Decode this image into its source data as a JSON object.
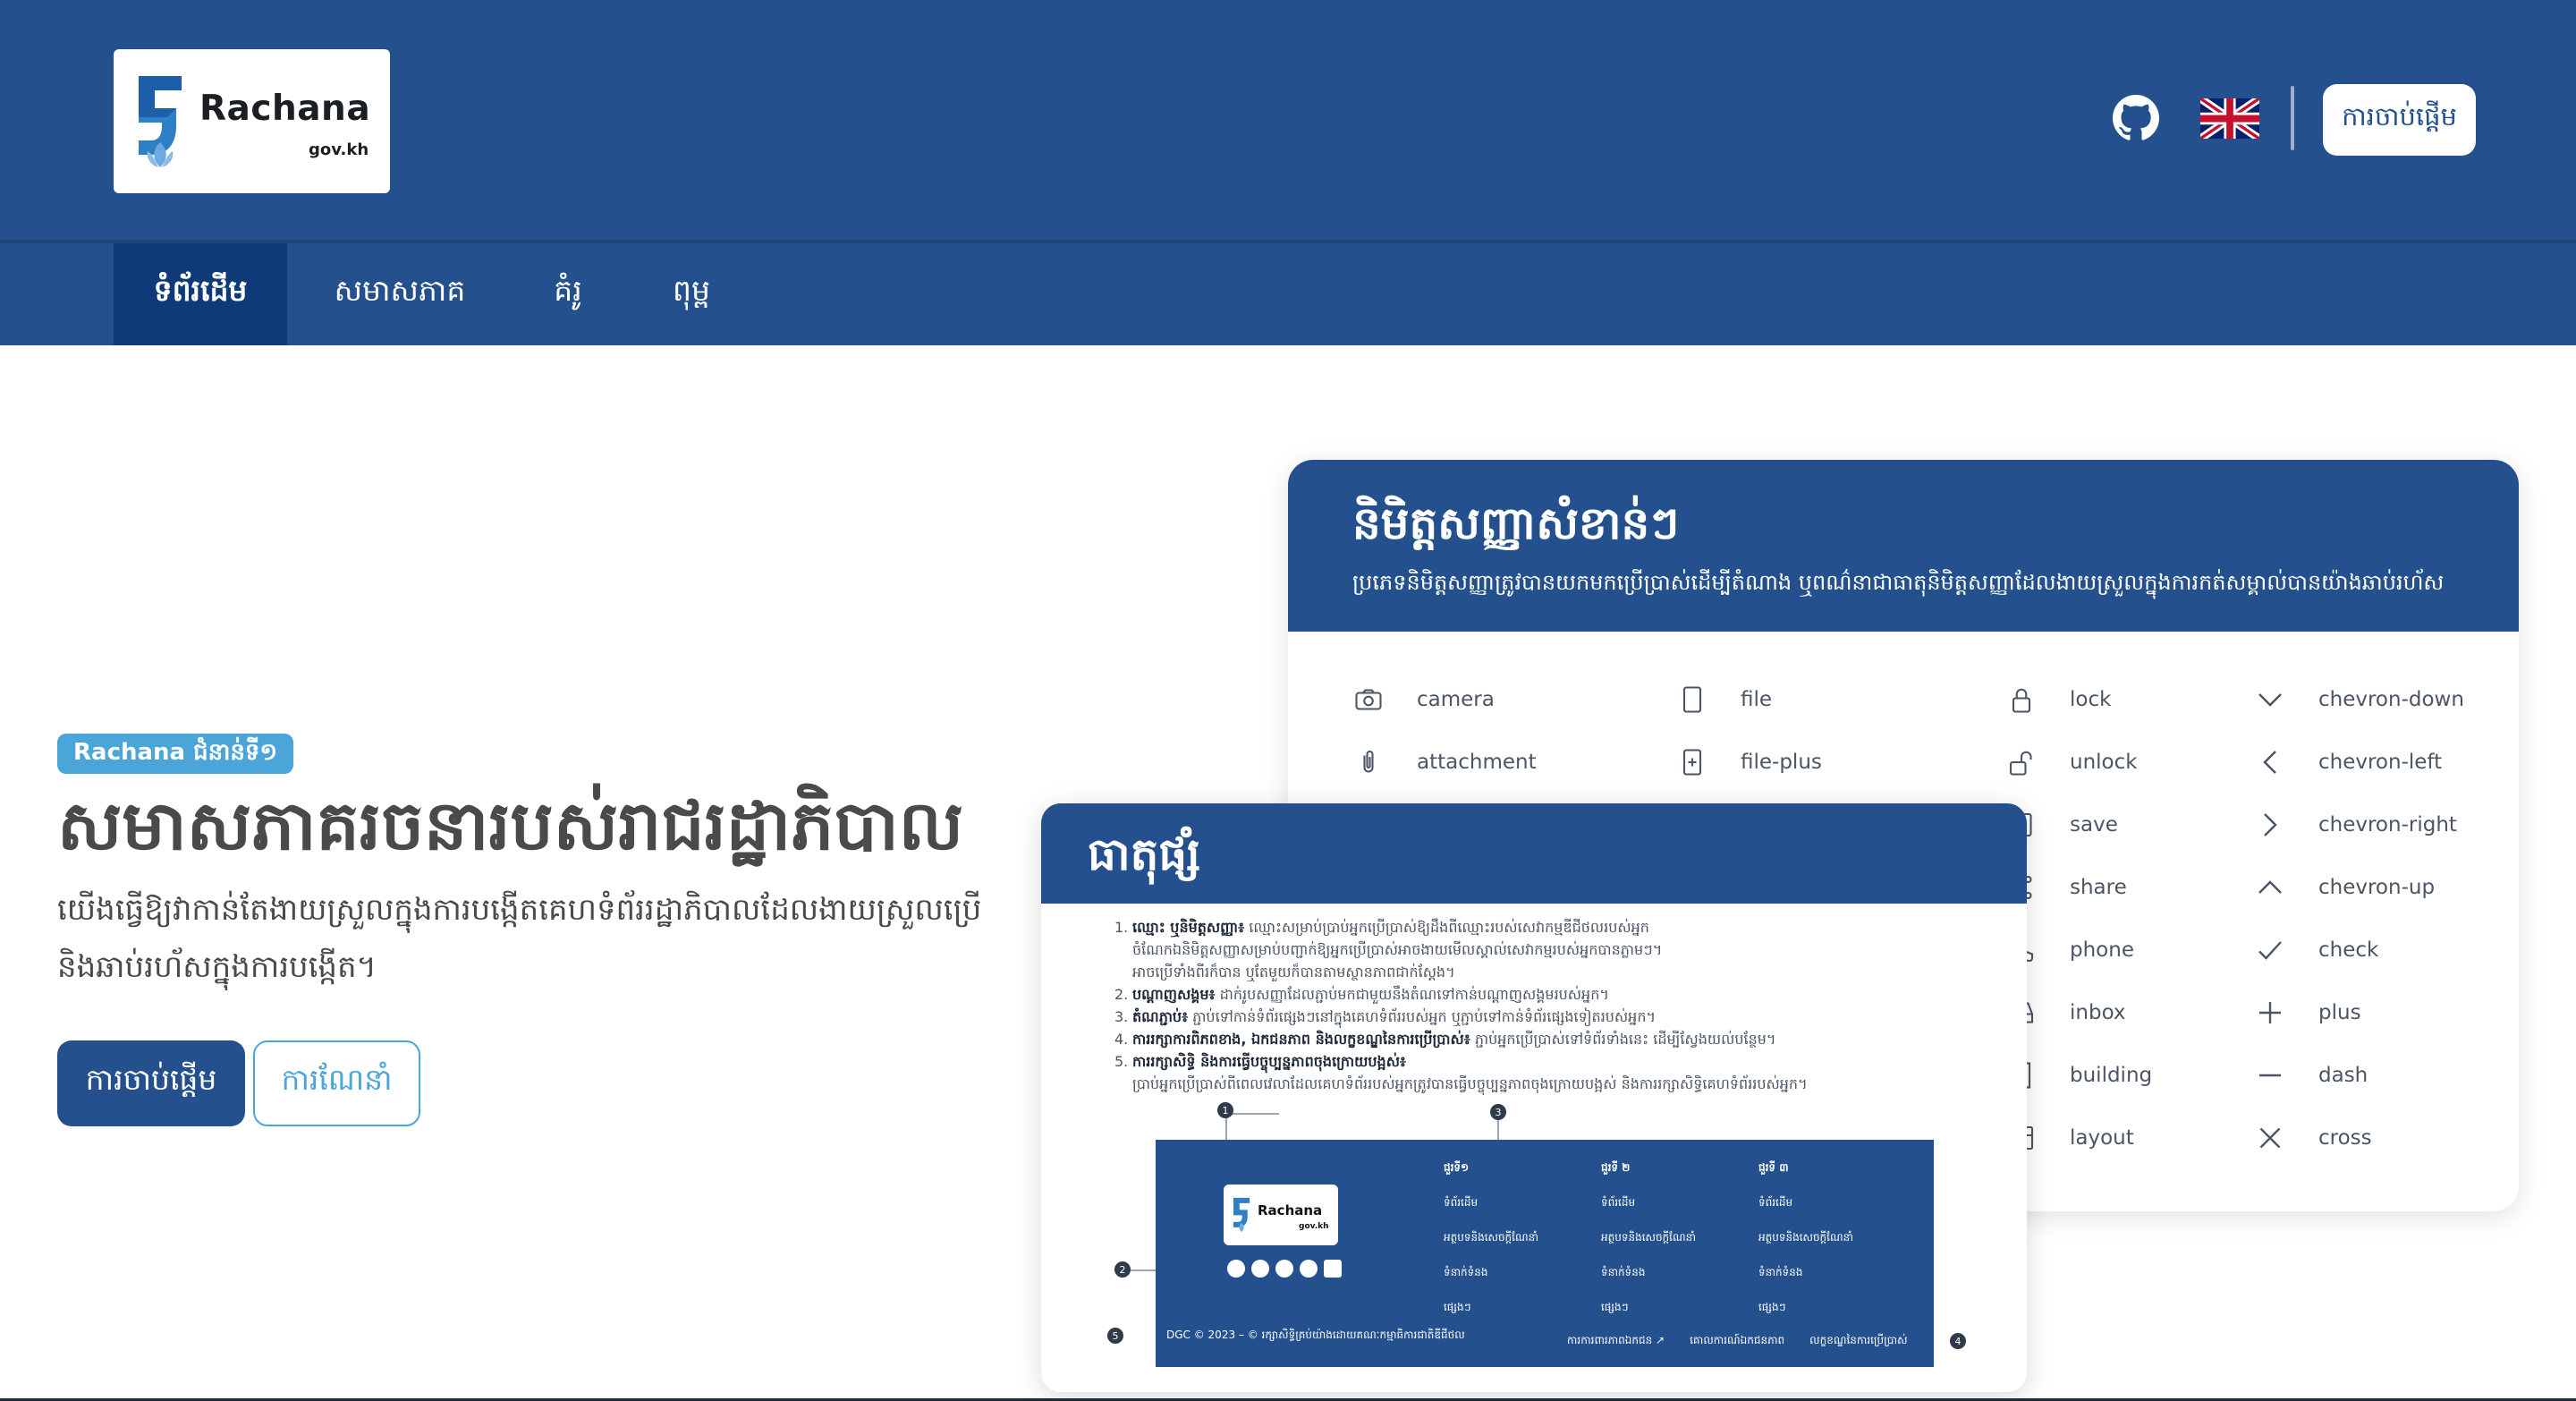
{
  "header": {
    "logo": {
      "wordmark": "Rachana",
      "domain": "gov.kh"
    },
    "icons": {
      "github": "github-icon",
      "language": "uk-flag-icon"
    },
    "start_button": "ការចាប់ផ្តើម"
  },
  "nav": {
    "items": [
      {
        "label": "ទំព័រដើម",
        "active": true
      },
      {
        "label": "សមាសភាគ",
        "active": false
      },
      {
        "label": "គំរូ",
        "active": false
      },
      {
        "label": "ពុម្ព",
        "active": false
      }
    ]
  },
  "hero": {
    "badge": "Rachana ជំនាន់ទី១",
    "title": "សមាសភាគរចនារបស់រាជរដ្ឋាភិបាល",
    "description": "យើងធ្វើឱ្យវាកាន់តែងាយស្រួលក្នុងការបង្កើតគេហទំព័ររដ្ឋាភិបាលដែលងាយស្រួលប្រើ និងឆាប់រហ័សក្នុងការបង្កើត។",
    "primary_button": "ការចាប់ផ្តើម",
    "secondary_button": "ការណែនាំ"
  },
  "icon_card": {
    "title": "និមិត្តសញ្ញាសំខាន់ៗ",
    "subtitle": "ប្រភេទនិមិត្តសញ្ញាត្រូវបានយកមកប្រើប្រាស់ដើម្បីតំណាង ឬពណ៌នាជាធាតុនិមិត្តសញ្ញាដែលងាយស្រួលក្នុងការកត់សម្គាល់បានយ៉ាងឆាប់រហ័ស",
    "icons": [
      "camera",
      "attachment",
      "file",
      "file-plus",
      "lock",
      "unlock",
      "save",
      "share",
      "phone",
      "inbox",
      "building",
      "layout",
      "chevron-down",
      "chevron-left",
      "chevron-right",
      "chevron-up",
      "check",
      "plus",
      "dash",
      "cross"
    ]
  },
  "component_card": {
    "title": "ធាតុផ្សំ",
    "notes": [
      {
        "n": "1.",
        "bold": "ឈ្មោះ ឬនិមិត្តសញ្ញា៖",
        "text": " ឈ្មោះសម្រាប់ប្រាប់អ្នកប្រើប្រាស់ឱ្យដឹងពីឈ្មោះរបស់សេវាកម្មឌីជីថលរបស់អ្នក"
      },
      {
        "n": "",
        "bold": "",
        "text": "ចំណែកឯនិមិត្តសញ្ញាសម្រាប់បញ្ជាក់ឱ្យអ្នកប្រើប្រាស់អាចងាយមើលស្គាល់សេវាកម្មរបស់អ្នកបានភ្លាមៗ។"
      },
      {
        "n": "",
        "bold": "",
        "text": "អាចប្រើទាំងពីរក៏បាន ឬតែមួយក៏បានតាមស្ថានភាពជាក់ស្តែង។"
      },
      {
        "n": "2.",
        "bold": "បណ្តាញសង្គម៖",
        "text": " ដាក់រូបសញ្ញាដែលភ្ជាប់មកជាមួយនឹងតំណទៅកាន់បណ្តាញសង្គមរបស់អ្នក។"
      },
      {
        "n": "3.",
        "bold": "តំណភ្ជាប់៖",
        "text": " ភ្ជាប់ទៅកាន់ទំព័រផ្សេងៗនៅក្នុងគេហទំព័ររបស់អ្នក ឬភ្ជាប់ទៅកាន់ទំព័រផ្សេងទៀតរបស់អ្នក។"
      },
      {
        "n": "4.",
        "bold": "ការរក្សាការពិភពខាង, ឯកជនភាព និងលក្ខខណ្ឌនៃការប្រើប្រាស់៖",
        "text": " ភ្ជាប់អ្នកប្រើប្រាស់ទៅទំព័រទាំងនេះ ដើម្បីស្វែងយល់បន្ថែម។"
      },
      {
        "n": "5.",
        "bold": "ការរក្សាសិទ្ធិ និងការធ្វើបច្ចុប្បន្នភាពចុងក្រោយបង្អស់៖",
        "text": ""
      },
      {
        "n": "",
        "bold": "",
        "text": "ប្រាប់អ្នកប្រើប្រាស់ពីពេលវេលាដែលគេហទំព័ររបស់អ្នកត្រូវបានធ្វើបច្ចុប្បន្នភាពចុងក្រោយបង្អស់ និងការរក្សាសិទ្ធិគេហទំព័ររបស់អ្នក។"
      }
    ],
    "footer_preview": {
      "logo_word": "Rachana",
      "logo_domain": "gov.kh",
      "columns": [
        {
          "heading": "ជួរទី១",
          "links": [
            "ទំព័រដើម",
            "អត្ថបទនិងសេចក្តីណែនាំ",
            "ទំនាក់ទំនង",
            "ផ្សេងៗ"
          ]
        },
        {
          "heading": "ជួរទី ២",
          "links": [
            "ទំព័រដើម",
            "អត្ថបទនិងសេចក្តីណែនាំ",
            "ទំនាក់ទំនង",
            "ផ្សេងៗ"
          ]
        },
        {
          "heading": "ជួរទី ៣",
          "links": [
            "ទំព័រដើម",
            "អត្ថបទនិងសេចក្តីណែនាំ",
            "ទំនាក់ទំនង",
            "ផ្សេងៗ"
          ]
        }
      ],
      "copyright": "DGC © 2023 – © រក្សាសិទ្ធិគ្រប់យ៉ាងដោយគណៈកម្មាធិការជាតិឌីជីថល",
      "bottom_links": [
        "ការការពារភាពឯកជន ↗",
        "គោលការណ៍ឯកជនភាព",
        "លក្ខខណ្ឌនៃការប្រើប្រាស់"
      ],
      "callouts": [
        "1",
        "2",
        "3",
        "4",
        "5"
      ]
    }
  },
  "colors": {
    "primary": "#24508e",
    "accent": "#4ca5d8",
    "active_nav": "#0f3a78"
  }
}
